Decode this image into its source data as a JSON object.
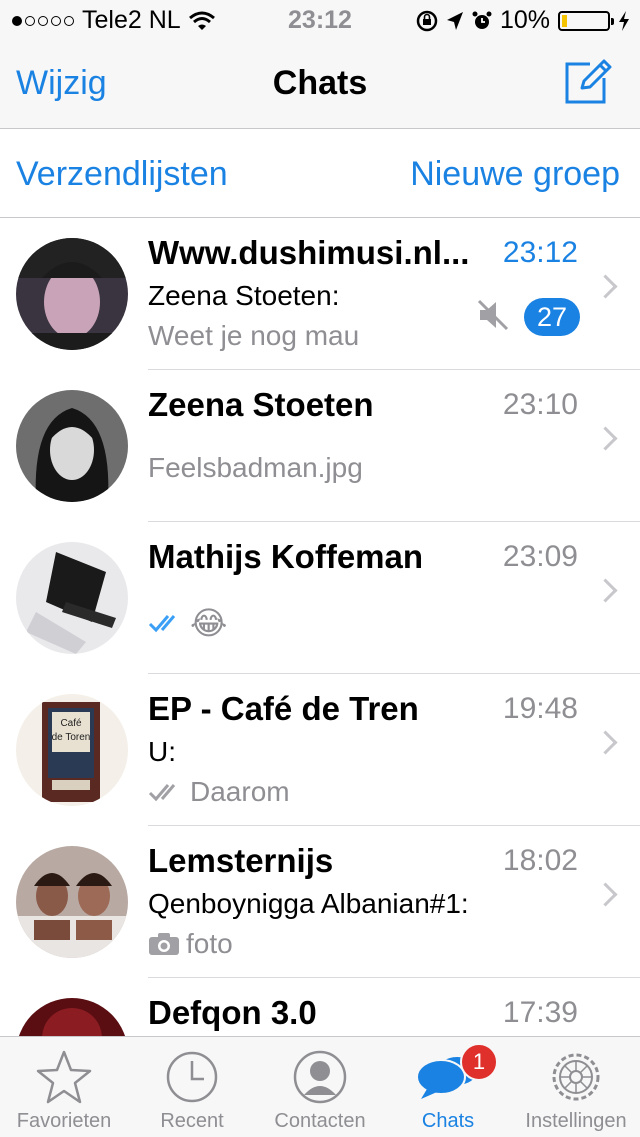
{
  "status_bar": {
    "carrier": "Tele2 NL",
    "signal_dots_filled": 1,
    "signal_dots_total": 5,
    "time": "23:12",
    "battery_percent": "10%",
    "battery_level": 0.1,
    "battery_color": "#f5c400"
  },
  "nav": {
    "edit_label": "Wijzig",
    "title": "Chats",
    "compose_icon": "compose-icon"
  },
  "actions": {
    "broadcast_label": "Verzendlijsten",
    "new_group_label": "Nieuwe groep"
  },
  "chats": [
    {
      "name": "Www.dushimusi.nl...",
      "time": "23:12",
      "sender": "Zeena Stoeten:",
      "preview": "Weet je nog mau",
      "muted": true,
      "unread": "27"
    },
    {
      "name": "Zeena Stoeten",
      "time": "23:10",
      "sender": "",
      "preview": "Feelsbadman.jpg"
    },
    {
      "name": "Mathijs Koffeman",
      "time": "23:09",
      "sender": "",
      "preview": "😂",
      "read_ticks": true
    },
    {
      "name": "EP - Café de Tren",
      "time": "19:48",
      "sender": "U:",
      "preview": "Daarom",
      "read_ticks": true,
      "avatar_text_1": "Café",
      "avatar_text_2": "de Toren"
    },
    {
      "name": "Lemsternijs",
      "time": "18:02",
      "sender": "Qenboynigga Albanian#1:",
      "preview": "foto",
      "camera": true
    },
    {
      "name": "Defqon 3.0",
      "time": "17:39",
      "sender": "",
      "preview": ""
    }
  ],
  "tabs": [
    {
      "label": "Favorieten",
      "icon": "star-icon"
    },
    {
      "label": "Recent",
      "icon": "clock-icon"
    },
    {
      "label": "Contacten",
      "icon": "contacts-icon"
    },
    {
      "label": "Chats",
      "icon": "chats-icon",
      "badge": "1",
      "active": true
    },
    {
      "label": "Instellingen",
      "icon": "gear-icon"
    }
  ],
  "colors": {
    "accent": "#1a82e2",
    "badge_red": "#e0302b"
  }
}
